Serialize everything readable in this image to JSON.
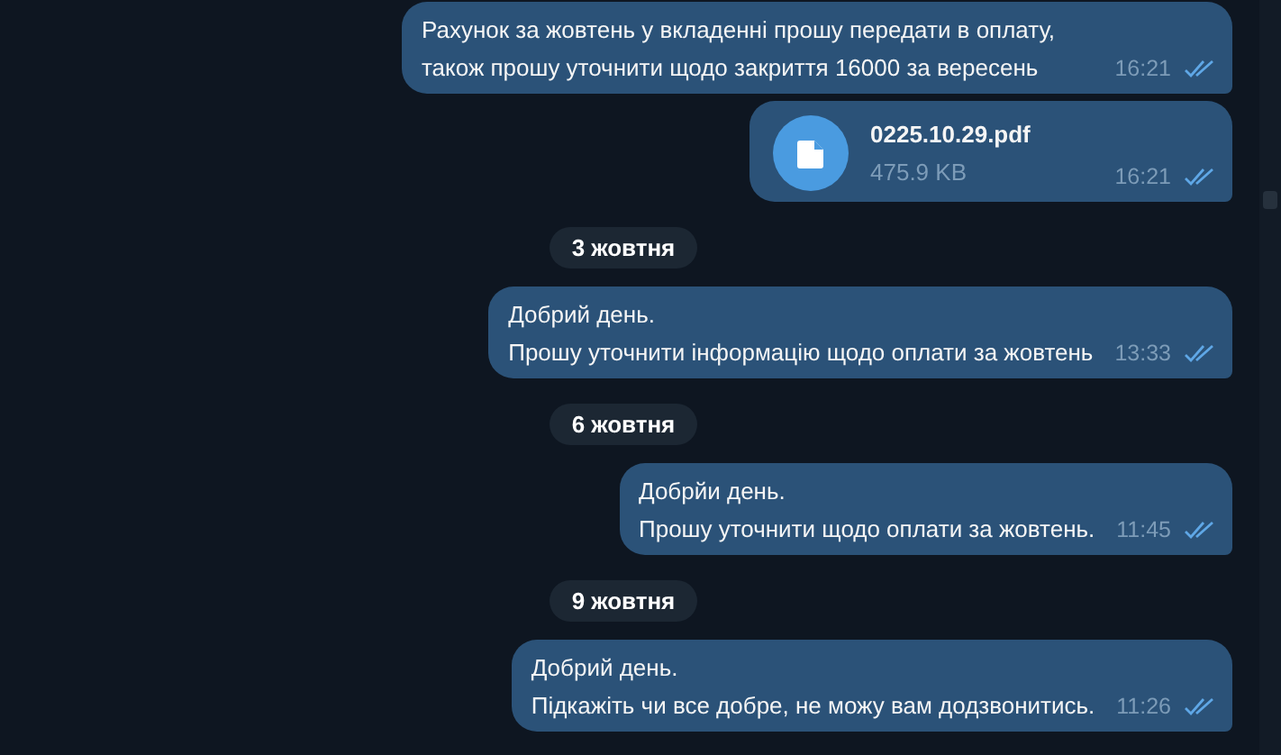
{
  "messages": [
    {
      "kind": "text",
      "text": "Рахунок за жовтень у вкладенні прошу передати в оплату, також прошу уточнити щодо закриття 16000 за вересень",
      "time": "16:21",
      "read": true
    },
    {
      "kind": "file",
      "file_name": "0225.10.29.pdf",
      "file_size": "475.9 KB",
      "time": "16:21",
      "read": true
    },
    {
      "kind": "date",
      "text": "3 жовтня"
    },
    {
      "kind": "text",
      "text": "Добрий день.\nПрошу уточнити інформацію щодо оплати за жовтень",
      "time": "13:33",
      "read": true
    },
    {
      "kind": "date",
      "text": "6 жовтня"
    },
    {
      "kind": "text",
      "text": "Добрйи день.\nПрошу уточнити щодо оплати за жовтень.",
      "time": "11:45",
      "read": true
    },
    {
      "kind": "date",
      "text": "9 жовтня"
    },
    {
      "kind": "text",
      "text": "Добрий день.\nПідкажіть чи все добре, не можу вам додзвонитись.",
      "time": "11:26",
      "read": true
    }
  ]
}
